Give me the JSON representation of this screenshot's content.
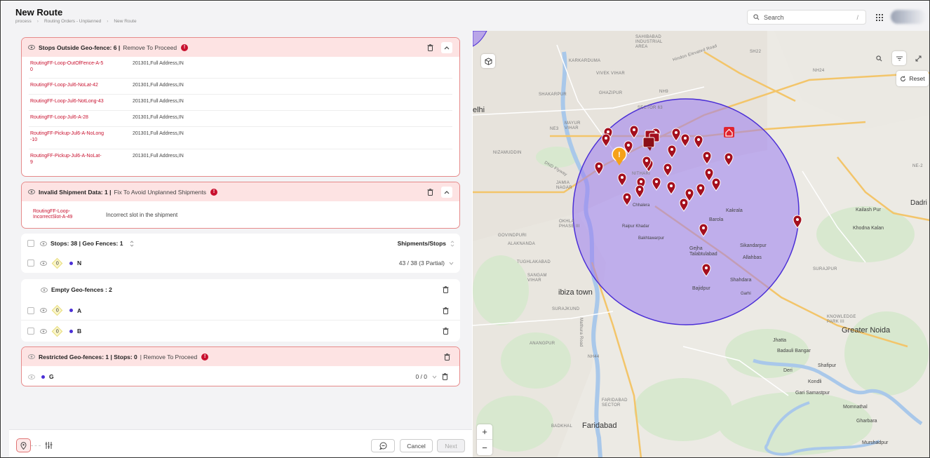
{
  "header": {
    "title": "New Route",
    "breadcrumb": [
      "process",
      "Routing Orders - Unplanned",
      "New Route"
    ],
    "search_placeholder": "Search",
    "search_shortcut": "/"
  },
  "outside_fence": {
    "title": "Stops Outside Geo-fence: 6 |",
    "action": "Remove To Proceed",
    "badge": "!",
    "rows": [
      {
        "id": "RoutingFF-Loop-OutOfFence-A-5\n0",
        "address": "201301,Full Address,IN"
      },
      {
        "id": "RoutingFF-Loop-Jul6-NoLat-42",
        "address": "201301,Full Address,IN"
      },
      {
        "id": "RoutingFF-Loop-Jul6-NotLong-43",
        "address": "201301,Full Address,IN"
      },
      {
        "id": "RoutingFF-Loop-Jul6-A-28",
        "address": "201301,Full Address,IN"
      },
      {
        "id": "RoutingFF-Pickup-Jul6-A-NoLong\n-10",
        "address": "201301,Full Address,IN"
      },
      {
        "id": "RoutingFF-Pickup-Jul6-A-NoLat-\n9",
        "address": "201301,Full Address,IN"
      }
    ]
  },
  "invalid_shipment": {
    "title": "Invalid Shipment Data: 1 |",
    "action": "Fix To Avoid Unplanned Shipments",
    "badge": "!",
    "row_id": "RoutingFF-Loop-\nIncorrectSlot-A-49",
    "row_msg": "Incorrect slot in the shipment"
  },
  "stops": {
    "summary": "Stops: 38 | Geo Fences: 1",
    "column": "Shipments/Stops",
    "fence": {
      "count": "0",
      "name": "N",
      "value": "43 / 38 (3 Partial)"
    }
  },
  "empty_fences": {
    "title": "Empty Geo-fences : 2",
    "items": [
      {
        "count": "0",
        "name": "A"
      },
      {
        "count": "0",
        "name": "B"
      }
    ]
  },
  "restricted": {
    "title": "Restricted Geo-fences: 1 | Stops: 0",
    "action": "| Remove To Proceed",
    "badge": "!",
    "fence": {
      "name": "G",
      "value": "0 / 0"
    }
  },
  "footer": {
    "cancel": "Cancel",
    "next": "Next"
  },
  "map": {
    "reset": "Reset",
    "zoom_in": "+",
    "zoom_out": "−",
    "fence_color": "#9b7bf0",
    "pin_color": "#a40f1e",
    "labels": {
      "delhi": "elhi",
      "ibiza": "ibiza town",
      "greater_noida": "Greater Noida",
      "faridabad": "Faridabad",
      "dadri": "Dadri",
      "kailash": "Kailash Pur",
      "khodna": "Khodna Kalan",
      "kakrala": "Kakrala",
      "barola": "Barola",
      "sikandarpur": "Sikandarpur",
      "gejha": "Gejha\nTalabtulabad",
      "allahbas": "Allahbas",
      "shahdara": "Shahdara",
      "bajidpur": "Bajidpur",
      "garhi": "Garhi",
      "chhalera": "Chhalera",
      "raipur": "Raipur Khadar",
      "bakhtawarpur": "Bakhtawarpur",
      "jhatta": "Jhatta",
      "badauli": "Badauli Bangar",
      "deri": "Deri",
      "shafipur": "Shafipur",
      "kondli": "Kondli",
      "gari": "Gari Samastpur",
      "momnathal": "Momnathal",
      "gharbara": "Gharbara",
      "murshadpur": "Murshadpur",
      "sahibabad": "SAHIBABAD\nINDUSTRIAL\nAREA",
      "karkarduma": "KARKARDUMA",
      "vivek": "VIVEK VIHAR",
      "shakarpur": "SHAKARPUR",
      "ghazipur": "GHAZIPUR",
      "mayur": "MAYUR\nVIHAR",
      "nizamuddin": "NIZAMUDDIN",
      "jamia": "JAMIA\nNAGAR",
      "okhla": "OKHLA\nPHASE III",
      "govindpuri": "GOVINDPURI",
      "alaknanda": "ALAKNANDA",
      "tughlakabad": "TUGHLAKABAD",
      "sangam": "SANGAM\nVIHAR",
      "surajkund": "SURAJKUND",
      "anangpur": "ANANGPUR",
      "badkhal": "BADKHAL",
      "faridabad_lbl": "FARIDABAD\nSECTOR",
      "surajpur": "SURAJPUR",
      "knowledge": "KNOWLEDGE\nPARK III",
      "mathura": "Mathura Road",
      "sector63": "SECTOR 63",
      "nithari": "NITHARI",
      "hindon": "Hindon Elevated Road",
      "nh9": "NH9",
      "ne3": "NE3",
      "nh24": "NH24",
      "ne2": "NE-2",
      "sh22": "SH22",
      "nh44": "NH44",
      "dnd": "DND Flyway"
    }
  }
}
